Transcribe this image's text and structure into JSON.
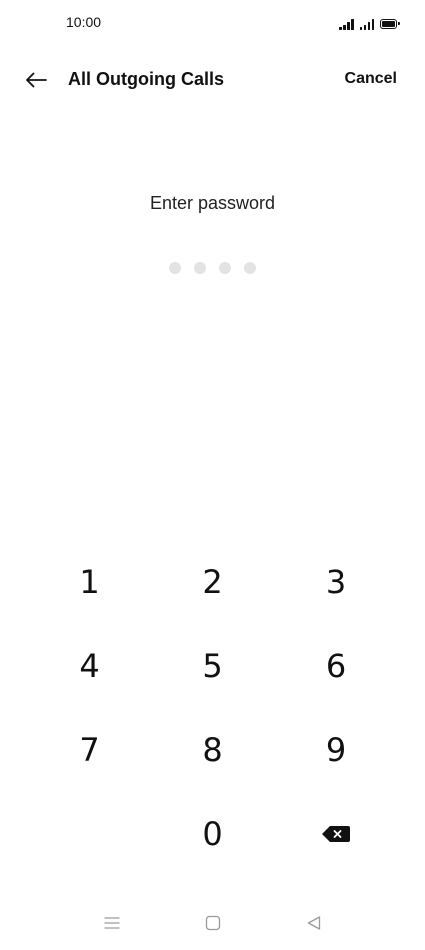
{
  "status_bar": {
    "time": "10:00",
    "icons": [
      "signal-icon",
      "signal-icon",
      "battery-icon"
    ]
  },
  "header": {
    "back_icon": "arrow-left-icon",
    "title": "All Outgoing Calls",
    "cancel_label": "Cancel"
  },
  "password": {
    "prompt": "Enter password",
    "digits_total": 4,
    "digits_entered": 0
  },
  "keypad": {
    "keys": [
      "1",
      "2",
      "3",
      "4",
      "5",
      "6",
      "7",
      "8",
      "9",
      "",
      "0"
    ],
    "backspace_icon": "backspace-icon"
  },
  "nav_bar": {
    "icons": [
      "menu-icon",
      "home-square-icon",
      "back-triangle-icon"
    ]
  },
  "colors": {
    "background": "#ffffff",
    "text": "#111111",
    "dot_empty": "#e3e3e3",
    "nav_icon": "#9a9a9a"
  }
}
